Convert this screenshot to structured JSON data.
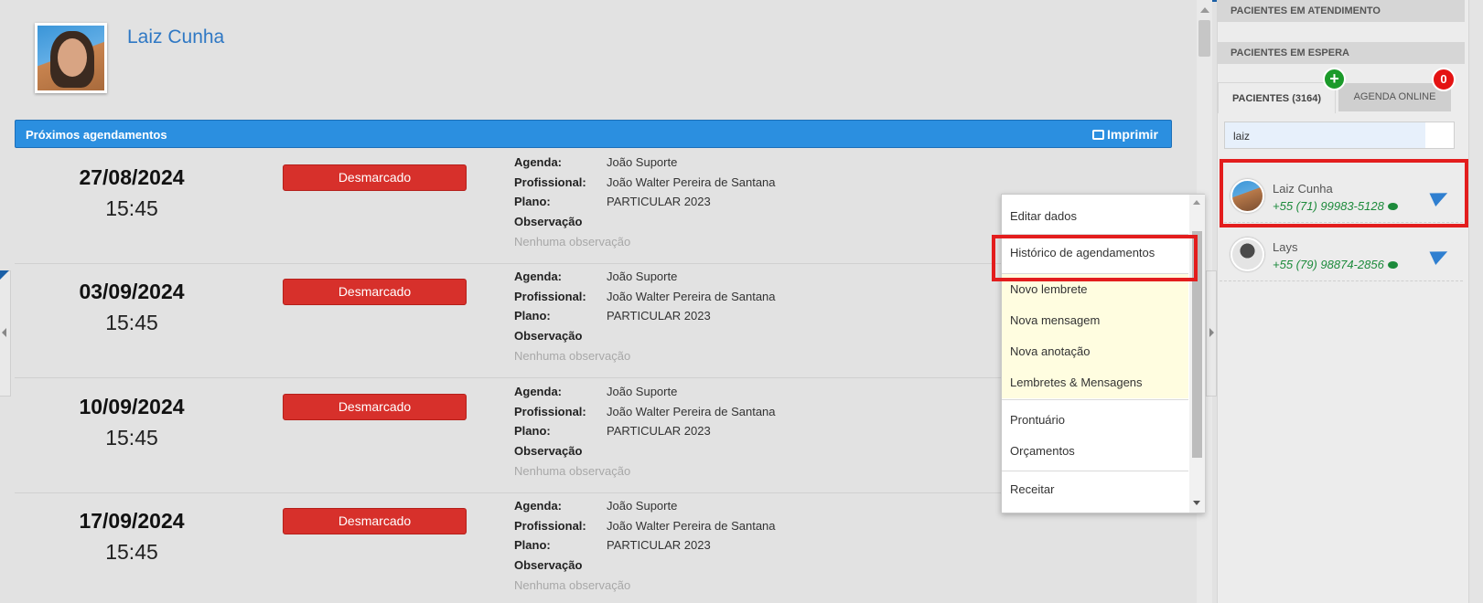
{
  "patient": {
    "name": "Laiz Cunha"
  },
  "upcoming": {
    "title": "Próximos agendamentos",
    "print_label": "Imprimir",
    "labels": {
      "agenda": "Agenda:",
      "profissional": "Profissional:",
      "plano": "Plano:",
      "observacao": "Observação"
    },
    "appointments": [
      {
        "date": "27/08/2024",
        "time": "15:45",
        "status": "Desmarcado",
        "agenda": "João Suporte",
        "profissional": "João Walter Pereira de Santana",
        "plano": "PARTICULAR 2023",
        "observacao": "Nenhuma observação"
      },
      {
        "date": "03/09/2024",
        "time": "15:45",
        "status": "Desmarcado",
        "agenda": "João Suporte",
        "profissional": "João Walter Pereira de Santana",
        "plano": "PARTICULAR 2023",
        "observacao": "Nenhuma observação"
      },
      {
        "date": "10/09/2024",
        "time": "15:45",
        "status": "Desmarcado",
        "agenda": "João Suporte",
        "profissional": "João Walter Pereira de Santana",
        "plano": "PARTICULAR 2023",
        "observacao": "Nenhuma observação"
      },
      {
        "date": "17/09/2024",
        "time": "15:45",
        "status": "Desmarcado",
        "agenda": "João Suporte",
        "profissional": "João Walter Pereira de Santana",
        "plano": "PARTICULAR 2023",
        "observacao": "Nenhuma observação"
      }
    ]
  },
  "context_menu": {
    "items": [
      {
        "label": "Editar dados"
      },
      {
        "label": "Histórico de agendamentos"
      },
      {
        "label": "Novo lembrete"
      },
      {
        "label": "Nova mensagem"
      },
      {
        "label": "Nova anotação"
      },
      {
        "label": "Lembretes & Mensagens"
      },
      {
        "label": "Prontuário"
      },
      {
        "label": "Orçamentos"
      },
      {
        "label": "Receitar"
      }
    ]
  },
  "sidebar": {
    "in_service_title": "PACIENTES EM ATENDIMENTO",
    "waiting_title": "PACIENTES EM ESPERA",
    "tab_patients": "PACIENTES (3164)",
    "tab_online": "AGENDA ONLINE",
    "plus_symbol": "+",
    "online_count": "0",
    "search": {
      "value": "laiz"
    },
    "patients": [
      {
        "name": "Laiz Cunha",
        "phone": "+55 (71) 99983-5128"
      },
      {
        "name": "Lays",
        "phone": "+55 (79) 98874-2856"
      }
    ]
  },
  "colors": {
    "accent_blue": "#2b8fe0",
    "status_red": "#d7302b",
    "highlight_red": "#e31d1d",
    "phone_green": "#1c8a3b"
  }
}
